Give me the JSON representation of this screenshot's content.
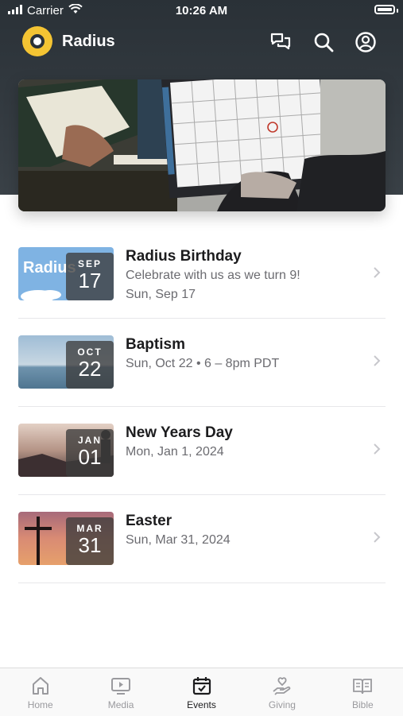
{
  "status_bar": {
    "carrier": "Carrier",
    "time": "10:26 AM"
  },
  "header": {
    "app_name": "Radius"
  },
  "events": [
    {
      "title": "Radius Birthday",
      "subtitle": "Celebrate with us as we turn 9!",
      "detail": "Sun, Sep 17",
      "month": "SEP",
      "day": "17",
      "thumb_text": "Radius"
    },
    {
      "title": "Baptism",
      "subtitle": "Sun, Oct 22 • 6 – 8pm PDT",
      "detail": "",
      "month": "OCT",
      "day": "22"
    },
    {
      "title": "New Years Day",
      "subtitle": "Mon, Jan 1, 2024",
      "detail": "",
      "month": "JAN",
      "day": "01"
    },
    {
      "title": "Easter",
      "subtitle": "Sun, Mar 31, 2024",
      "detail": "",
      "month": "MAR",
      "day": "31"
    }
  ],
  "tabs": [
    {
      "label": "Home",
      "icon": "home-icon",
      "active": false
    },
    {
      "label": "Media",
      "icon": "media-icon",
      "active": false
    },
    {
      "label": "Events",
      "icon": "calendar-icon",
      "active": true
    },
    {
      "label": "Giving",
      "icon": "giving-icon",
      "active": false
    },
    {
      "label": "Bible",
      "icon": "bible-icon",
      "active": false
    }
  ],
  "colors": {
    "header_bg": "#2a3137",
    "logo_accent": "#f4c433",
    "active_tab": "#1c1c1e",
    "inactive_tab": "#9a9a9e"
  }
}
